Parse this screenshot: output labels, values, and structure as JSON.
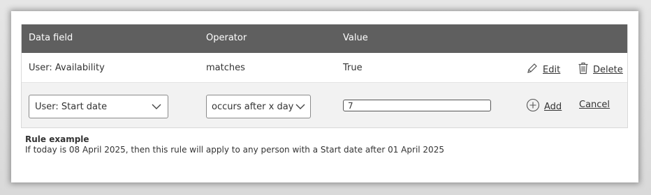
{
  "table": {
    "headers": [
      "Data field",
      "Operator",
      "Value"
    ],
    "rows": [
      {
        "field": "User: Availability",
        "operator": "matches",
        "value": "True",
        "edit_label": "Edit",
        "delete_label": "Delete"
      }
    ],
    "new_row": {
      "field_selected": "User: Start date",
      "operator_selected": "occurs after x days a",
      "value": "7",
      "add_label": "Add",
      "cancel_label": "Cancel"
    }
  },
  "example": {
    "title": "Rule example",
    "text": "If today is 08 April 2025, then this rule will apply to any person with a Start date after 01 April 2025"
  },
  "colors": {
    "header_bg": "#5f5f5f",
    "header_text": "#ffffff",
    "row_alt_bg": "#f2f2f2"
  }
}
